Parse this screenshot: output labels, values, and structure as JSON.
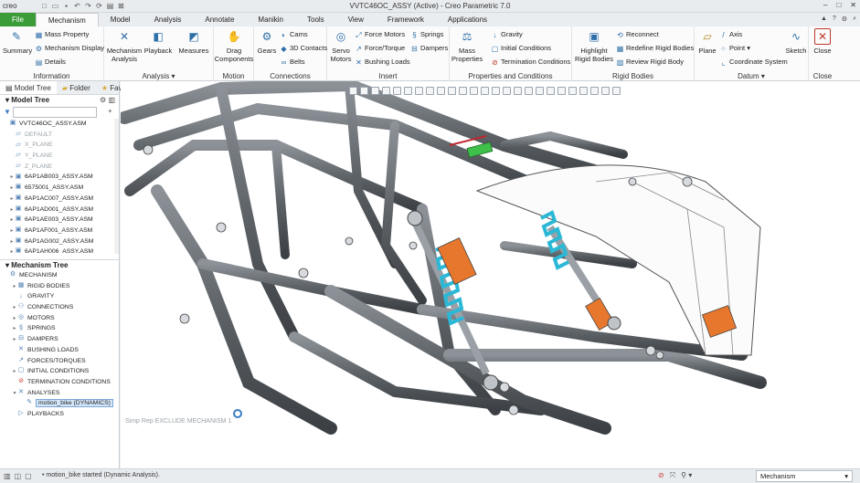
{
  "window": {
    "app_logo": "creo",
    "title": "VVTC46OC_ASSY (Active) - Creo Parametric 7.0",
    "controls": [
      "–",
      "□",
      "✕"
    ]
  },
  "tabs": [
    "File",
    "Mechanism",
    "Model",
    "Analysis",
    "Annotate",
    "Manikin",
    "Tools",
    "View",
    "Framework",
    "Applications"
  ],
  "ribbon": {
    "information": {
      "label": "Information",
      "summary": "Summary",
      "mass_property": "Mass Property",
      "mechanism_display": "Mechanism Display",
      "details": "Details"
    },
    "analysis": {
      "label": "Analysis",
      "mechanism_analysis": "Mechanism Analysis",
      "playback": "Playback",
      "measures": "Measures"
    },
    "motion": {
      "label": "Motion",
      "drag_components": "Drag Components"
    },
    "connections": {
      "label": "Connections",
      "gears": "Gears",
      "cams": "Cams",
      "contacts_3d": "3D Contacts",
      "belts": "Belts"
    },
    "insert": {
      "label": "Insert",
      "servo_motors": "Servo Motors",
      "force_motors": "Force Motors",
      "force_torque": "Force/Torque",
      "bushing_loads": "Bushing Loads",
      "springs": "Springs",
      "dampers": "Dampers"
    },
    "properties": {
      "label": "Properties and Conditions",
      "mass_properties": "Mass Properties",
      "gravity": "Gravity",
      "initial_conditions": "Initial Conditions",
      "termination_conditions": "Termination Conditions"
    },
    "rigid_bodies": {
      "label": "Rigid Bodies",
      "highlight": "Highlight Rigid Bodies",
      "reconnect": "Reconnect",
      "redefine": "Redefine Rigid Bodies",
      "review": "Review Rigid Body"
    },
    "datum": {
      "label": "Datum",
      "plane": "Plane",
      "axis": "Axis",
      "point": "Point",
      "coordinate_system": "Coordinate System",
      "sketch": "Sketch"
    },
    "close": {
      "label": "Close",
      "close": "Close"
    }
  },
  "left_panel": {
    "tabs": [
      "Model Tree",
      "Folder",
      "Favorites"
    ],
    "model_tree_title": "Model Tree",
    "model_tree": [
      {
        "label": "VVTC46OC_ASSY.ASM",
        "dim": false,
        "expand": ""
      },
      {
        "label": "DEFAULT",
        "dim": true,
        "expand": ""
      },
      {
        "label": "X_PLANE",
        "dim": true,
        "expand": ""
      },
      {
        "label": "Y_PLANE",
        "dim": true,
        "expand": ""
      },
      {
        "label": "Z_PLANE",
        "dim": true,
        "expand": ""
      },
      {
        "label": "6AP1AB003_ASSY.ASM",
        "dim": false,
        "expand": "▸"
      },
      {
        "label": "6575001_ASSY.ASM",
        "dim": false,
        "expand": "▸"
      },
      {
        "label": "6AP1AC007_ASSY.ASM",
        "dim": false,
        "expand": "▸"
      },
      {
        "label": "6AP1AD001_ASSY.ASM",
        "dim": false,
        "expand": "▸"
      },
      {
        "label": "6AP1AE003_ASSY.ASM",
        "dim": false,
        "expand": "▸"
      },
      {
        "label": "6AP1AF001_ASSY.ASM",
        "dim": false,
        "expand": "▸"
      },
      {
        "label": "6AP1AG002_ASSY.ASM",
        "dim": false,
        "expand": "▸"
      },
      {
        "label": "6AP1AH006_ASSY.ASM",
        "dim": false,
        "expand": "▸"
      }
    ],
    "mechanism_tree_title": "Mechanism Tree",
    "mechanism_tree": [
      {
        "label": "MECHANISM",
        "expand": "",
        "indent": 0,
        "selected": false
      },
      {
        "label": "RIGID BODIES",
        "expand": "▸",
        "indent": 1,
        "selected": false
      },
      {
        "label": "GRAVITY",
        "expand": "",
        "indent": 1,
        "selected": false
      },
      {
        "label": "CONNECTIONS",
        "expand": "▸",
        "indent": 1,
        "selected": false
      },
      {
        "label": "MOTORS",
        "expand": "▸",
        "indent": 1,
        "selected": false
      },
      {
        "label": "SPRINGS",
        "expand": "▸",
        "indent": 1,
        "selected": false
      },
      {
        "label": "DAMPERS",
        "expand": "▸",
        "indent": 1,
        "selected": false
      },
      {
        "label": "BUSHING LOADS",
        "expand": "",
        "indent": 1,
        "selected": false
      },
      {
        "label": "FORCES/TORQUES",
        "expand": "",
        "indent": 1,
        "selected": false
      },
      {
        "label": "INITIAL CONDITIONS",
        "expand": "▸",
        "indent": 1,
        "selected": false
      },
      {
        "label": "TERMINATION CONDITIONS",
        "expand": "",
        "indent": 1,
        "selected": false
      },
      {
        "label": "ANALYSES",
        "expand": "▾",
        "indent": 1,
        "selected": false
      },
      {
        "label": "motion_bike (DYNAMICS)",
        "expand": "",
        "indent": 2,
        "selected": true
      },
      {
        "label": "PLAYBACKS",
        "expand": "",
        "indent": 1,
        "selected": false
      }
    ]
  },
  "viewport": {
    "simrep_text": "Simp Rep EXCLUDE MECHANISM 1"
  },
  "status": {
    "message": "motion_bike started (Dynamic Analysis).",
    "filter": "Mechanism"
  },
  "colors": {
    "file_tab": "#3d9c3a",
    "spring": "#2bb8d6",
    "damper_body": "#e8772e",
    "frame": "#6b6f74"
  }
}
